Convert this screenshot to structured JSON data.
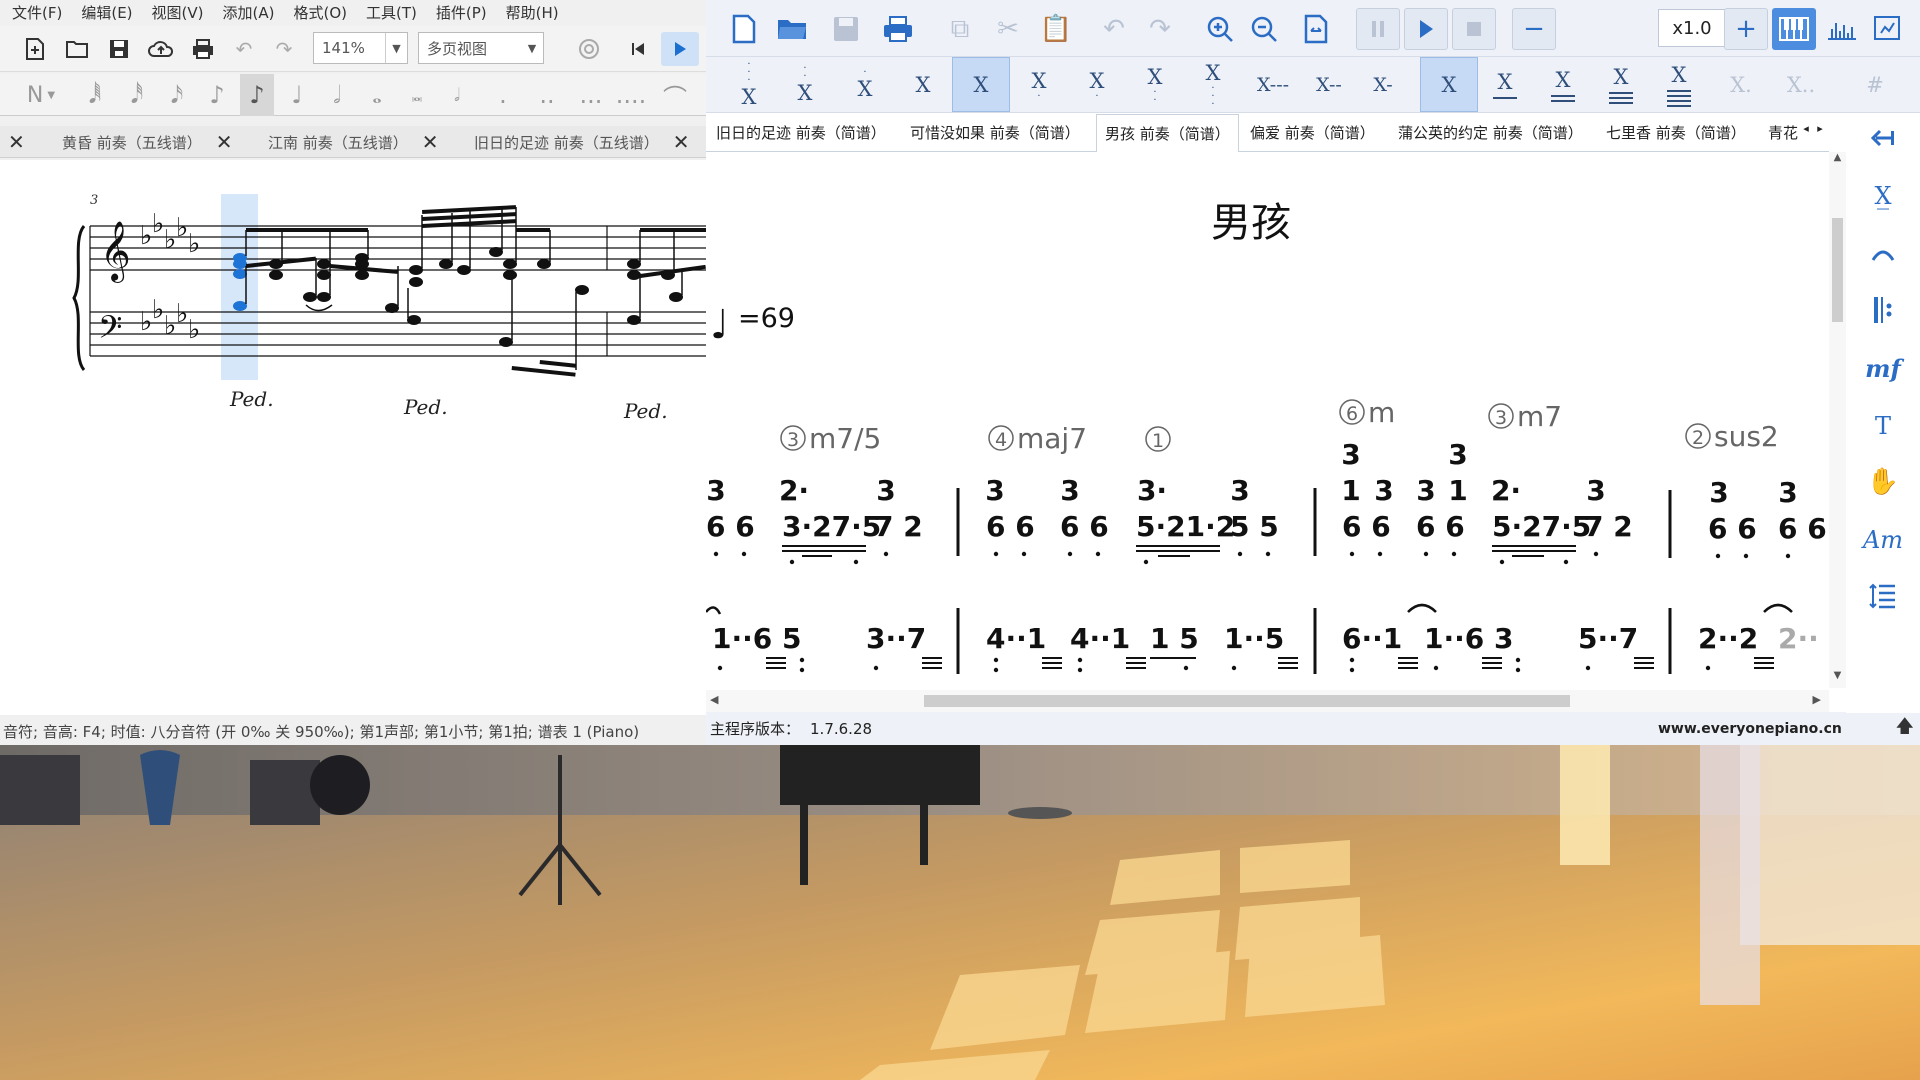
{
  "left": {
    "menu": [
      "文件(F)",
      "编辑(E)",
      "视图(V)",
      "添加(A)",
      "格式(O)",
      "工具(T)",
      "插件(P)",
      "帮助(H)"
    ],
    "zoom": "141%",
    "view_mode": "多页视图",
    "tabs": [
      {
        "label": "黄昏 前奏（五线谱）"
      },
      {
        "label": "江南 前奏（五线谱）"
      },
      {
        "label": "旧日的足迹 前奏（五线谱）"
      }
    ],
    "score": {
      "measure_number": "3",
      "pedal_marks": [
        "Ped.",
        "Ped.",
        "Ped."
      ]
    },
    "status": "音符; 音高: F4; 时值: 八分音符 (开 0‰ 关 950‰); 第1声部; 第1小节; 第1拍; 谱表 1 (Piano)"
  },
  "right": {
    "speed": "x1.0",
    "tabs": [
      "旧日的足迹 前奏（简谱）",
      "可惜没如果 前奏（简谱）",
      "男孩 前奏（简谱）",
      "偏爱 前奏（简谱）",
      "蒲公英的约定 前奏（简谱）",
      "七里香 前奏（简谱）",
      "青花"
    ],
    "active_tab": "男孩 前奏（简谱）",
    "duration_buttons": [
      "X",
      "X",
      "X",
      "X",
      "X",
      "X",
      "X",
      "X",
      "X",
      "X---",
      "X--",
      "X-",
      "X",
      "X",
      "X",
      "X",
      "X",
      "X.",
      "X.."
    ],
    "score": {
      "title": "男孩",
      "tempo": "=69",
      "chords": [
        {
          "circle": "3",
          "name": "m7/5"
        },
        {
          "circle": "4",
          "name": "maj7"
        },
        {
          "circle": "1",
          "name": ""
        },
        {
          "circle": "6",
          "name": "m"
        },
        {
          "circle": "3",
          "name": "m7"
        },
        {
          "circle": "2",
          "name": "sus2"
        }
      ],
      "row1_top": [
        "3",
        "2·",
        "3",
        "3",
        "3",
        "3·",
        "3",
        "3",
        "3",
        "2·",
        "3",
        "3",
        "3"
      ],
      "row1_mid": [
        "1",
        "3",
        "3",
        "1"
      ],
      "row1_bottom": [
        "6 6",
        "3·27·5",
        "7 2",
        "6 6",
        "6 6",
        "5·21·2",
        "5 5",
        "6 6",
        "6 6",
        "5·27·5",
        "7 2",
        "6 6",
        "6 6"
      ],
      "row2": [
        "1··6 5",
        "3··7",
        "4··1",
        "4··1",
        "1 5",
        "1··5",
        "6··1",
        "1··6 3",
        "5··7",
        "2··2",
        "2··"
      ]
    },
    "version_label": "主程序版本：",
    "version": "1.7.6.28",
    "website": "www.everyonepiano.cn",
    "side_tools": [
      "back-arrow-icon",
      "x-dot-icon",
      "slur-icon",
      "repeat-icon",
      "mf",
      "T",
      "hand-icon",
      "Am",
      "line-spacing-icon"
    ]
  }
}
